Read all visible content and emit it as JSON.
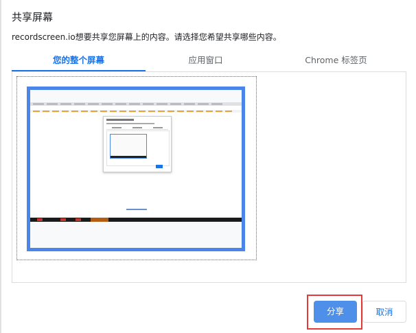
{
  "dialog": {
    "title": "共享屏幕",
    "subtitle": "recordscreen.io想要共享您屏幕上的内容。请选择您希望共享哪些内容。"
  },
  "tabs": [
    {
      "label": "您的整个屏幕",
      "active": true
    },
    {
      "label": "应用窗口",
      "active": false
    },
    {
      "label": "Chrome 标签页",
      "active": false
    }
  ],
  "screen_preview": {
    "selected": true
  },
  "buttons": {
    "share": "分享",
    "cancel": "取消"
  },
  "colors": {
    "accent": "#1a73e8",
    "share_button": "#4d8fe9",
    "selection_border": "#4a86e8",
    "highlight": "#e53935"
  }
}
